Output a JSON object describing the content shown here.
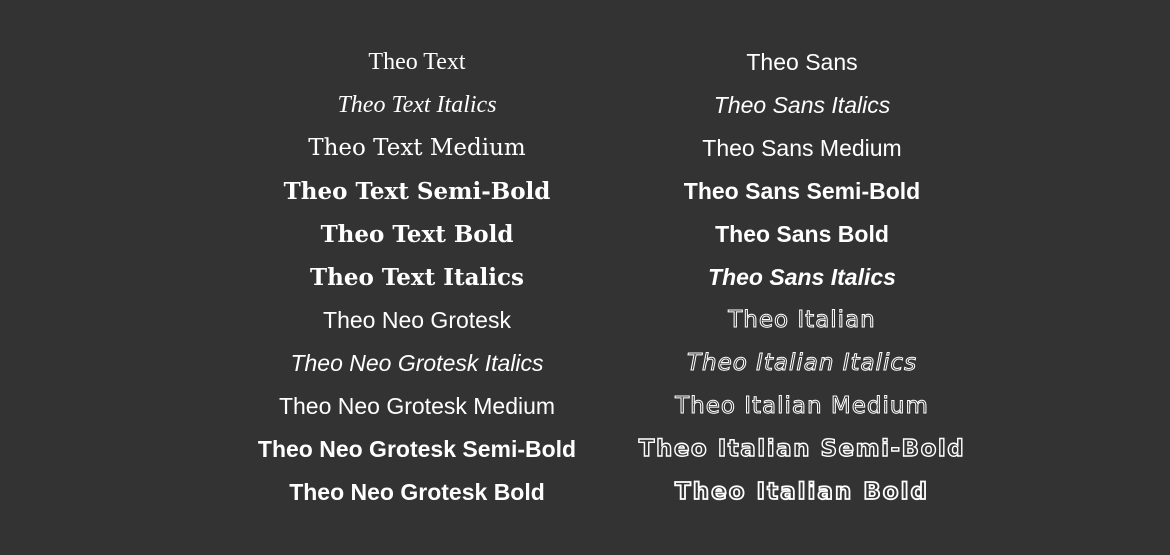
{
  "left_column": [
    "Theo Text",
    "Theo Text Italics",
    "Theo Text Medium",
    "Theo Text Semi-Bold",
    "Theo Text Bold",
    "Theo Text Italics",
    "Theo Neo Grotesk",
    "Theo Neo Grotesk Italics",
    "Theo Neo Grotesk Medium",
    "Theo Neo Grotesk Semi-Bold",
    "Theo Neo Grotesk Bold"
  ],
  "right_column": [
    "Theo Sans",
    "Theo Sans Italics",
    "Theo Sans Medium",
    "Theo Sans Semi-Bold",
    "Theo Sans Bold",
    "Theo Sans Italics",
    "Theo Italian",
    "Theo Italian Italics",
    "Theo Italian Medium",
    "Theo Italian Semi-Bold",
    "Theo Italian Bold"
  ],
  "colors": {
    "background": "#333333",
    "text": "#ffffff"
  }
}
